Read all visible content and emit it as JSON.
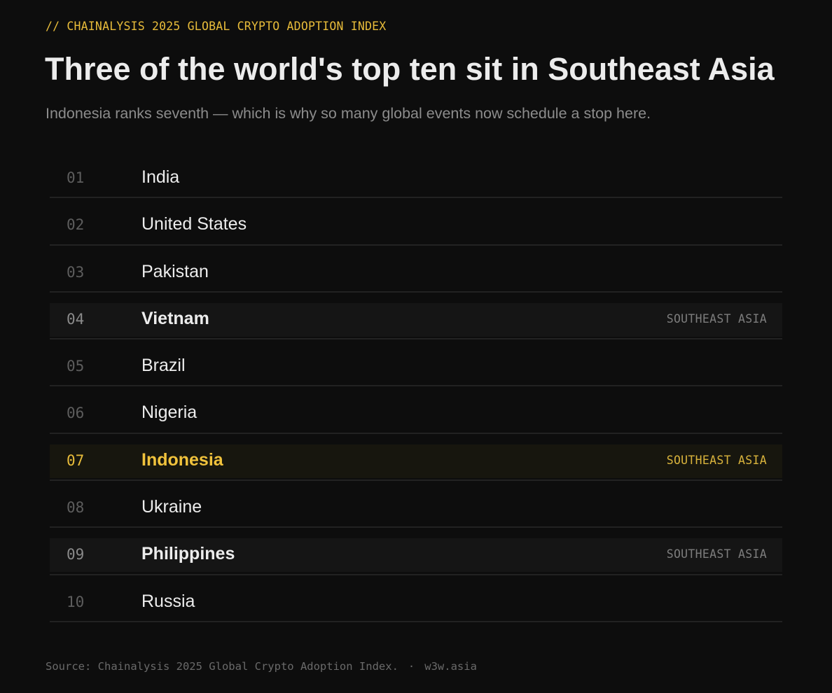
{
  "header": {
    "eyebrow": "// CHAINALYSIS 2025 GLOBAL CRYPTO ADOPTION INDEX",
    "title": "Three of the world's top ten sit in Southeast Asia",
    "subtitle": "Indonesia ranks seventh — which is why so many global events now schedule a stop here."
  },
  "colors": {
    "background": "#0d0d0d",
    "accent": "#e8bc3a",
    "text": "#ececec",
    "muted": "#8c8c8c"
  },
  "chart_data": {
    "type": "table",
    "columns": [
      "rank",
      "country",
      "region"
    ],
    "rows": [
      {
        "rank": "01",
        "country": "India",
        "region": "",
        "highlight": "none"
      },
      {
        "rank": "02",
        "country": "United States",
        "region": "",
        "highlight": "none"
      },
      {
        "rank": "03",
        "country": "Pakistan",
        "region": "",
        "highlight": "none"
      },
      {
        "rank": "04",
        "country": "Vietnam",
        "region": "SOUTHEAST ASIA",
        "highlight": "region"
      },
      {
        "rank": "05",
        "country": "Brazil",
        "region": "",
        "highlight": "none"
      },
      {
        "rank": "06",
        "country": "Nigeria",
        "region": "",
        "highlight": "none"
      },
      {
        "rank": "07",
        "country": "Indonesia",
        "region": "SOUTHEAST ASIA",
        "highlight": "focus"
      },
      {
        "rank": "08",
        "country": "Ukraine",
        "region": "",
        "highlight": "none"
      },
      {
        "rank": "09",
        "country": "Philippines",
        "region": "SOUTHEAST ASIA",
        "highlight": "region"
      },
      {
        "rank": "10",
        "country": "Russia",
        "region": "",
        "highlight": "none"
      }
    ]
  },
  "footer": {
    "source": "Source: Chainalysis 2025 Global Crypto Adoption Index.",
    "separator": "·",
    "site": "w3w.asia"
  }
}
